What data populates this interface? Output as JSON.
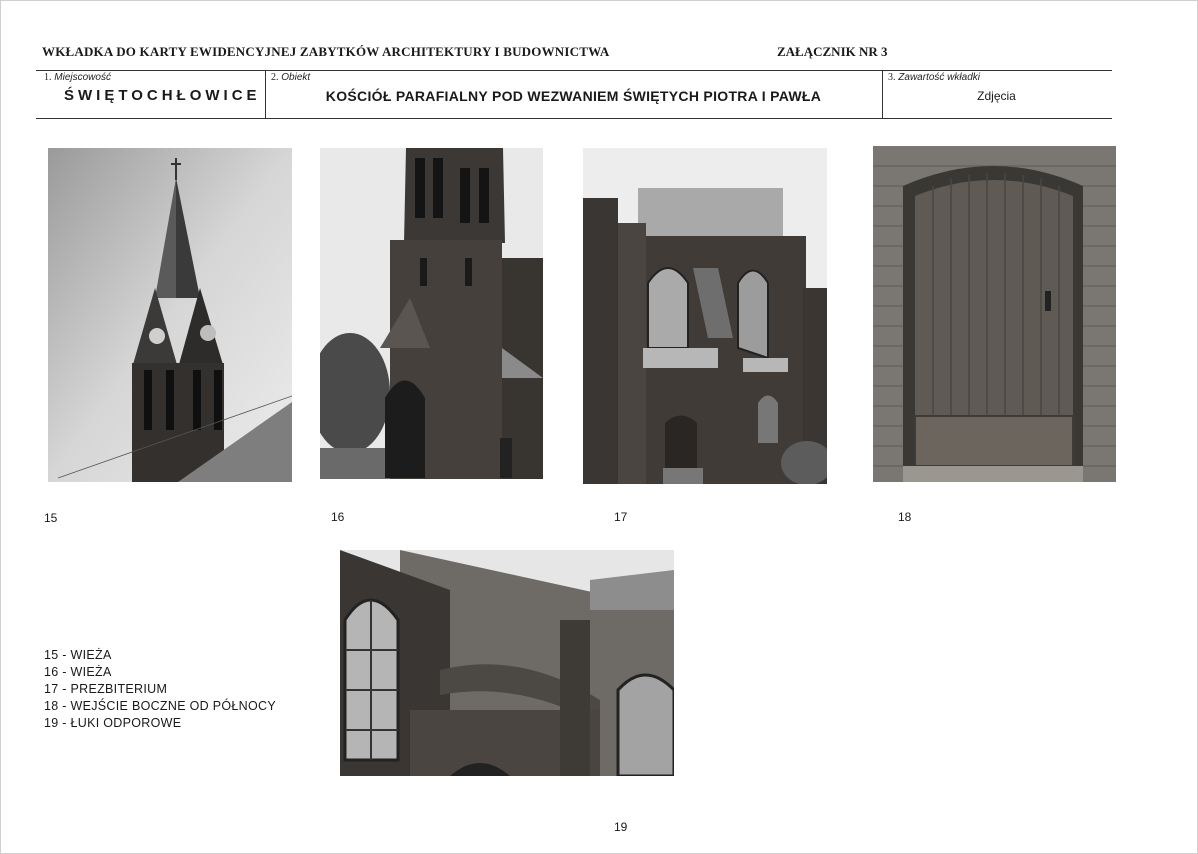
{
  "header": {
    "title": "WKŁADKA DO KARTY EWIDENCYJNEJ ZABYTKÓW ARCHITEKTURY I BUDOWNICTWA",
    "annex": "ZAŁĄCZNIK NR  3"
  },
  "fields": {
    "place": {
      "num": "1.",
      "label": "Miejscowość",
      "value": "ŚWIĘTOCHŁOWICE"
    },
    "object": {
      "num": "2.",
      "label": "Obiekt",
      "value": "KOŚCIÓŁ PARAFIALNY POD WEZWANIEM ŚWIĘTYCH PIOTRA I PAWŁA"
    },
    "contents": {
      "num": "3.",
      "label": "Zawartość wkładki",
      "value": "Zdjęcia"
    }
  },
  "photos": [
    {
      "number": "15"
    },
    {
      "number": "16"
    },
    {
      "number": "17"
    },
    {
      "number": "18"
    },
    {
      "number": "19"
    }
  ],
  "captions": [
    "15 - WIEŻA",
    "16 - WIEŻA",
    "17 - PREZBITERIUM",
    "18 - WEJŚCIE BOCZNE OD PÓŁNOCY",
    "19 - ŁUKI ODPOROWE"
  ]
}
